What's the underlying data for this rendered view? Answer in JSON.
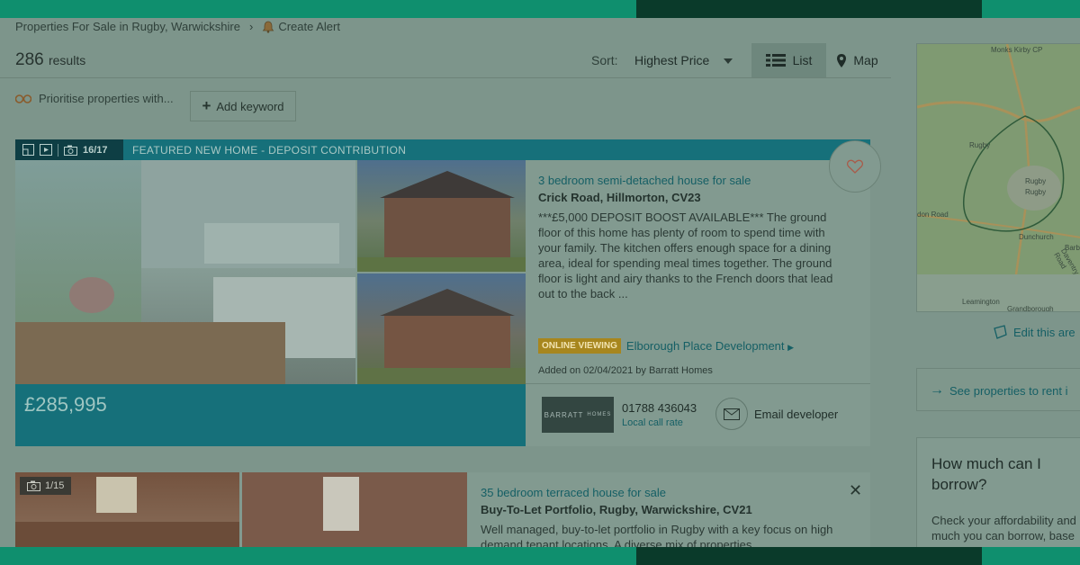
{
  "breadcrumb": {
    "location": "Properties For Sale in Rugby, Warwickshire",
    "separator": "›",
    "alert": "Create Alert"
  },
  "results": {
    "count": "286",
    "label": "results"
  },
  "sort": {
    "label": "Sort:",
    "value": "Highest Price"
  },
  "view": {
    "list": "List",
    "map": "Map"
  },
  "keywords": {
    "prioritise": "Prioritise properties with...",
    "add": "Add keyword"
  },
  "listing1": {
    "photo_count": "16/17",
    "banner": "FEATURED NEW HOME - DEPOSIT CONTRIBUTION",
    "price": "£285,995",
    "type": "3 bedroom semi-detached house for sale",
    "address": "Crick Road, Hillmorton, CV23",
    "summary": "***£5,000 DEPOSIT BOOST AVAILABLE*** The ground floor of this home has plenty of room to spend time with your family. The kitchen offers enough space for a dining area, ideal for spending meal times together. The ground floor is light and airy thanks to the French doors that lead out to the back ...",
    "online_badge": "ONLINE VIEWING",
    "development": "Elborough Place Development",
    "added": "Added on 02/04/2021 by Barratt Homes",
    "agent_logo": "BARRATT",
    "agent_logo_sub": "HOMES",
    "phone": "01788 436043",
    "call_rate": "Local call rate",
    "email": "Email developer"
  },
  "listing2": {
    "photo_count": "1/15",
    "type": "35 bedroom terraced house for sale",
    "address": "Buy-To-Let Portfolio, Rugby, Warwickshire, CV21",
    "summary": "Well managed, buy-to-let portfolio in Rugby with a key focus on high demand tenant locations. A diverse mix of properties"
  },
  "sidebar": {
    "map_labels": [
      "Monks Kirby CP",
      "Rugby",
      "Rugby",
      "Rugby",
      "Dunchurch",
      "Barby",
      "Leamington",
      "Grandborough",
      "Daventry Road",
      "don Road"
    ],
    "edit_area": "Edit this are",
    "rent_link": "See properties to rent i",
    "borrow_title": "How much can I borrow?",
    "borrow_text_1": "Check your affordability and",
    "borrow_text_2": "much you can borrow, base"
  }
}
